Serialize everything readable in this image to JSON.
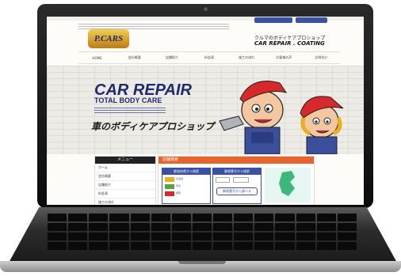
{
  "site": {
    "logo_text": "P.CARS",
    "tagline_jp": "クルマのボディケアプロショップ",
    "tagline_en": "CAR REPAIR . COATING"
  },
  "nav": {
    "items": [
      "HOME",
      "会社概要",
      "店舗紹介",
      "料金表",
      "施工の流れ",
      "お客様の声",
      "お問合せ"
    ]
  },
  "hero": {
    "title": "CAR REPAIR",
    "subtitle": "TOTAL BODY CARE",
    "tagline_jp": "車のボディケアプロショップ"
  },
  "menu": {
    "heading": "メニュー",
    "items": [
      "ホーム",
      "会社概要",
      "店舗紹介",
      "料金表",
      "施工の流れ"
    ]
  },
  "search": {
    "heading": "店舗検索",
    "card1_title": "都道府県から検索",
    "card2_title": "郵便番号から検索",
    "button_label": "郵便番号から調べる",
    "card1_cells": [
      "北海道",
      "東北",
      "関東"
    ]
  },
  "colors": {
    "brand_navy": "#1e2a6e",
    "accent_orange": "#e8642a",
    "link_blue": "#3a4fa8"
  }
}
